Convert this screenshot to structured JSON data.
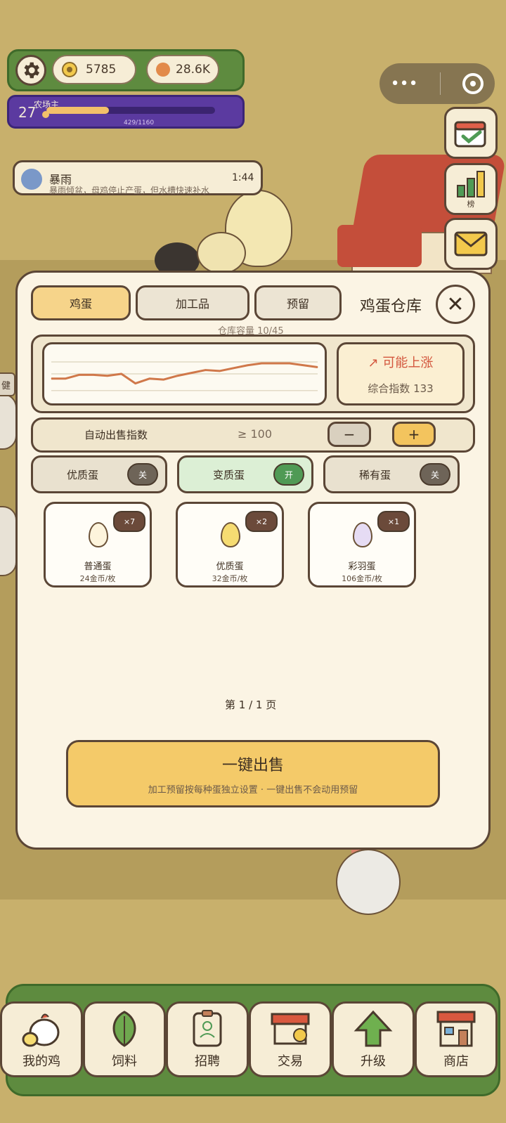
{
  "hud": {
    "gold": "5785",
    "gems": "28.6K",
    "level": "27",
    "level_title": "农场主",
    "xp_text": "429/1160",
    "xp_progress": 0.37
  },
  "side_buttons": [
    {
      "name": "ranking",
      "label": "榜"
    }
  ],
  "weather": {
    "title": "暴雨",
    "description": "暴雨倾盆，母鸡停止产蛋，但水槽快速补水",
    "time": "1:44"
  },
  "side_sign": "健",
  "panel": {
    "tabs": [
      "鸡蛋",
      "加工品",
      "预留"
    ],
    "title": "鸡蛋仓库",
    "capacity": "仓库容量 10/45",
    "trend_label": "↗ 可能上涨",
    "trend_index": "综合指数 133",
    "autosell_label": "自动出售指数",
    "autosell_value": "≥ 100",
    "minus": "−",
    "plus": "+",
    "toggles": [
      {
        "label": "优质蛋",
        "state": "关",
        "on": false
      },
      {
        "label": "变质蛋",
        "state": "开",
        "on": true
      },
      {
        "label": "稀有蛋",
        "state": "关",
        "on": false
      }
    ],
    "eggs": [
      {
        "name": "普通蛋",
        "price": "24金币/枚",
        "count": "×7",
        "color": "#fdf4dc"
      },
      {
        "name": "优质蛋",
        "price": "32金币/枚",
        "count": "×2",
        "color": "#f6dc72"
      },
      {
        "name": "彩羽蛋",
        "price": "106金币/枚",
        "count": "×1",
        "color": "#e6dcf4"
      }
    ],
    "pager": "第 1 / 1 页",
    "sell_label": "一键出售",
    "sell_hint": "加工预留按每种蛋独立设置 · 一键出售不会动用预留"
  },
  "chart_data": {
    "type": "line",
    "x": [
      0,
      1,
      2,
      3,
      4,
      5,
      6,
      7,
      8,
      9,
      10,
      11,
      12,
      13,
      14,
      15,
      16,
      17,
      18,
      19
    ],
    "series": [
      {
        "values": [
          80,
          80,
          88,
          88,
          86,
          90,
          70,
          80,
          78,
          86,
          92,
          98,
          96,
          102,
          108,
          112,
          112,
          112,
          108,
          104
        ]
      }
    ],
    "ylim": [
      40,
      140
    ],
    "grid": true,
    "color": "#d0784a"
  },
  "nav": [
    {
      "label": "我的鸡",
      "icon": "chicken-icon"
    },
    {
      "label": "饲料",
      "icon": "leaf-icon"
    },
    {
      "label": "招聘",
      "icon": "id-card-icon"
    },
    {
      "label": "交易",
      "icon": "market-stall-icon"
    },
    {
      "label": "升级",
      "icon": "up-arrow-icon"
    },
    {
      "label": "商店",
      "icon": "shop-icon"
    }
  ],
  "colors": {
    "accent": "#f4ca69",
    "panel": "#fbf4e4",
    "border": "#5b4636",
    "trend_up": "#d3563d",
    "toggle_on": "#4f9a55"
  }
}
